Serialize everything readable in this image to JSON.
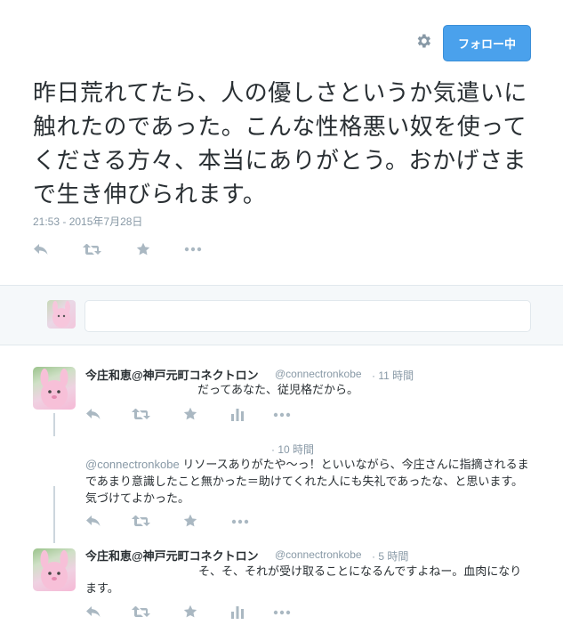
{
  "header": {
    "settings_icon": "gear-icon",
    "follow_label": "フォロー中"
  },
  "main_tweet": {
    "text": "昨日荒れてたら、人の優しさというか気遣いに触れたのであった。こんな性格悪い奴を使ってくださる方々、本当にありがとう。おかげさまで生き伸びられます。",
    "timestamp": "21:53 - 2015年7月28日",
    "actions": [
      "reply-icon",
      "retweet-icon",
      "favorite-icon",
      "more-icon"
    ]
  },
  "reply_box": {
    "placeholder": ""
  },
  "replies": [
    {
      "name": "今庄和恵@神戸元町コネクトロン",
      "handle": "@connectronkobe",
      "time": "· 11 時間",
      "text": "だってあなた、従児格だから。"
    },
    {
      "name": "",
      "handle": "",
      "time": "· 10 時間",
      "mention": "@connectronkobe",
      "text": " リソースありがたや〜っ！といいながら、今庄さんに指摘されるまであまり意識したこと無かった＝助けてくれた人にも失礼であったな、と思います。気づけてよかった。"
    },
    {
      "name": "今庄和恵@神戸元町コネクトロン",
      "handle": "@connectronkobe",
      "time": "· 5 時間",
      "text": "そ、そ、それが受け取ることになるんですよねー。血肉になります。"
    }
  ],
  "colors": {
    "accent": "#4aa1ec",
    "muted": "#8899a6",
    "icon": "#aab8c2"
  }
}
